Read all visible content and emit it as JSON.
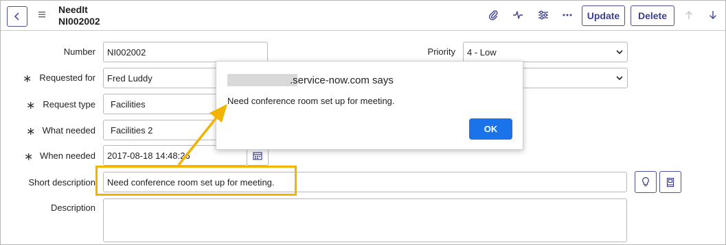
{
  "header": {
    "title": "NeedIt",
    "record_number": "NI002002",
    "update_label": "Update",
    "delete_label": "Delete",
    "icons": [
      "back-icon",
      "hamburger-menu-icon",
      "paperclip-icon",
      "activity-icon",
      "settings-sliders-icon",
      "more-options-icon",
      "arrow-up-icon",
      "arrow-down-icon"
    ]
  },
  "form": {
    "number": {
      "label": "Number",
      "value": "NI002002"
    },
    "requested_for": {
      "label": "Requested for",
      "value": "Fred Luddy"
    },
    "request_type": {
      "label": "Request type",
      "value": "Facilities"
    },
    "what_needed": {
      "label": "What needed",
      "value": "Facilities 2"
    },
    "when_needed": {
      "label": "When needed",
      "value": "2017-08-18 14:48:26"
    },
    "short_description": {
      "label": "Short description",
      "value": "Need conference room set up for meeting."
    },
    "description": {
      "label": "Description",
      "value": ""
    },
    "priority": {
      "label": "Priority",
      "value": "4 - Low"
    },
    "required_marker": "∗"
  },
  "dialog": {
    "title_suffix": ".service-now.com says",
    "message": "Need conference room set up for meeting.",
    "ok_label": "OK"
  },
  "colors": {
    "accent": "#4a4fa0",
    "dialog_button": "#1a73e8",
    "highlight": "#f2b400"
  }
}
